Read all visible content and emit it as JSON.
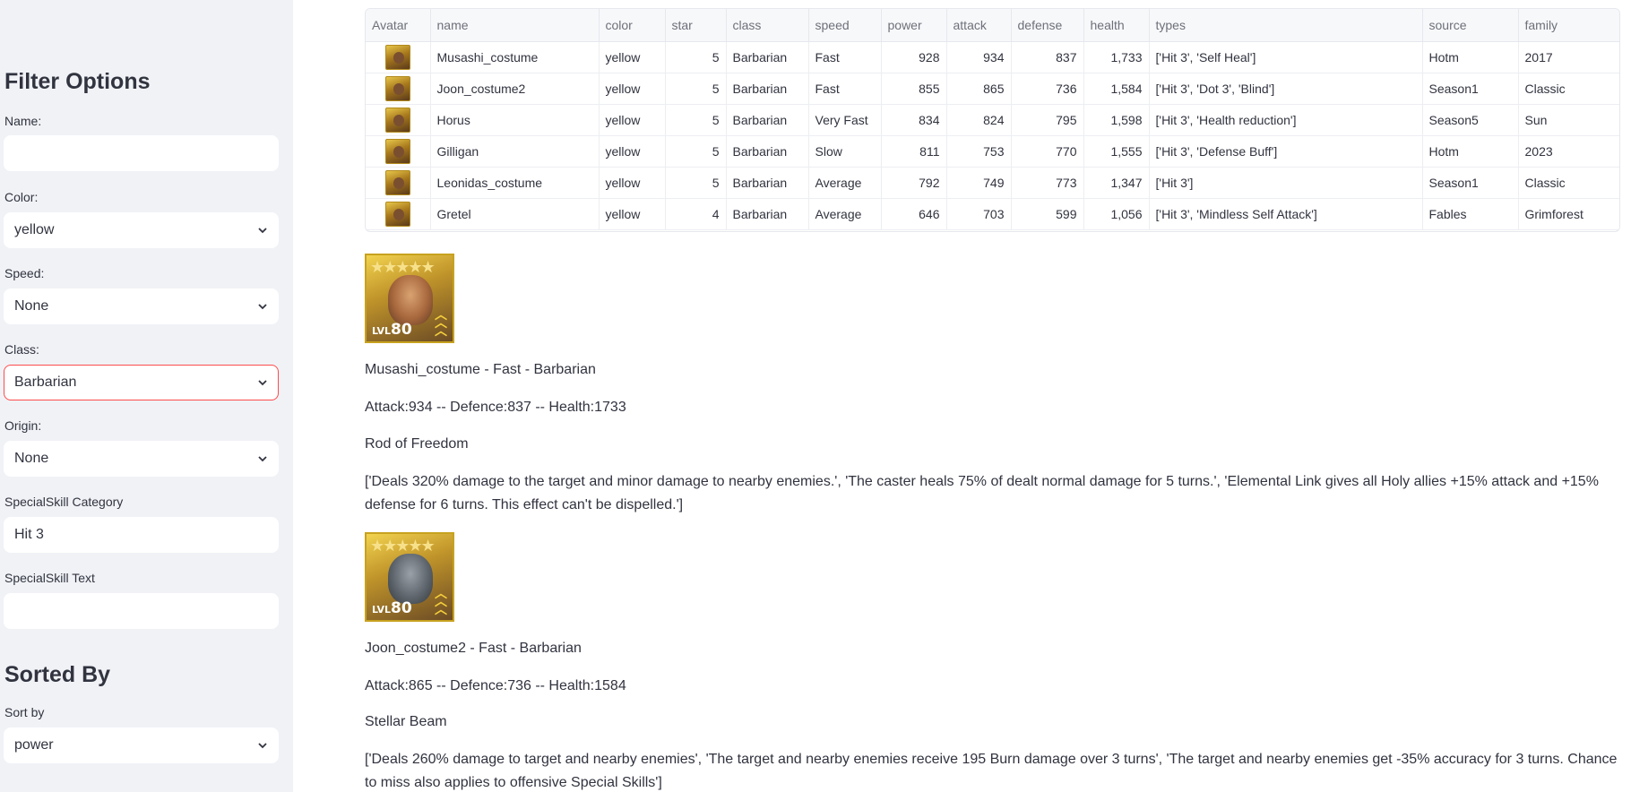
{
  "sidebar": {
    "filter_heading": "Filter Options",
    "name_label": "Name:",
    "name_value": "",
    "color_label": "Color:",
    "color_value": "yellow",
    "speed_label": "Speed:",
    "speed_value": "None",
    "class_label": "Class:",
    "class_value": "Barbarian",
    "origin_label": "Origin:",
    "origin_value": "None",
    "skill_category_label": "SpecialSkill Category",
    "skill_category_value": "Hit 3",
    "skill_text_label": "SpecialSkill Text",
    "skill_text_value": "",
    "sorted_heading": "Sorted By",
    "sort_label": "Sort by",
    "sort_value": "power",
    "accent_color": "#ff4b4b"
  },
  "table": {
    "columns": [
      "Avatar",
      "name",
      "color",
      "star",
      "class",
      "speed",
      "power",
      "attack",
      "defense",
      "health",
      "types",
      "source",
      "family"
    ],
    "rows": [
      [
        "",
        "Musashi_costume",
        "yellow",
        "5",
        "Barbarian",
        "Fast",
        "928",
        "934",
        "837",
        "1,733",
        "['Hit 3', 'Self Heal']",
        "Hotm",
        "2017"
      ],
      [
        "",
        "Joon_costume2",
        "yellow",
        "5",
        "Barbarian",
        "Fast",
        "855",
        "865",
        "736",
        "1,584",
        "['Hit 3', 'Dot 3', 'Blind']",
        "Season1",
        "Classic"
      ],
      [
        "",
        "Horus",
        "yellow",
        "5",
        "Barbarian",
        "Very Fast",
        "834",
        "824",
        "795",
        "1,598",
        "['Hit 3', 'Health reduction']",
        "Season5",
        "Sun"
      ],
      [
        "",
        "Gilligan",
        "yellow",
        "5",
        "Barbarian",
        "Slow",
        "811",
        "753",
        "770",
        "1,555",
        "['Hit 3', 'Defense Buff']",
        "Hotm",
        "2023"
      ],
      [
        "",
        "Leonidas_costume",
        "yellow",
        "5",
        "Barbarian",
        "Average",
        "792",
        "749",
        "773",
        "1,347",
        "['Hit 3']",
        "Season1",
        "Classic"
      ],
      [
        "",
        "Gretel",
        "yellow",
        "4",
        "Barbarian",
        "Average",
        "646",
        "703",
        "599",
        "1,056",
        "['Hit 3', 'Mindless Self Attack']",
        "Fables",
        "Grimforest"
      ]
    ]
  },
  "heroes": [
    {
      "stars": "★★★★★",
      "level_prefix": "LVL",
      "level": "80",
      "title": "Musashi_costume - Fast - Barbarian",
      "stats": "Attack:934 -- Defence:837 -- Health:1733",
      "skill_name": "Rod of Freedom",
      "skill_desc": "['Deals 320% damage to the target and minor damage to nearby enemies.', 'The caster heals 75% of dealt normal damage for 5 turns.', 'Elemental Link gives all Holy allies +15% attack and +15% defense for 6 turns. This effect can't be dispelled.']"
    },
    {
      "stars": "★★★★★",
      "level_prefix": "LVL",
      "level": "80",
      "title": "Joon_costume2 - Fast - Barbarian",
      "stats": "Attack:865 -- Defence:736 -- Health:1584",
      "skill_name": "Stellar Beam",
      "skill_desc": "['Deals 260% damage to target and nearby enemies', 'The target and nearby enemies receive 195 Burn damage over 3 turns', 'The target and nearby enemies get -35% accuracy for 3 turns. Chance to miss also applies to offensive Special Skills']"
    }
  ]
}
